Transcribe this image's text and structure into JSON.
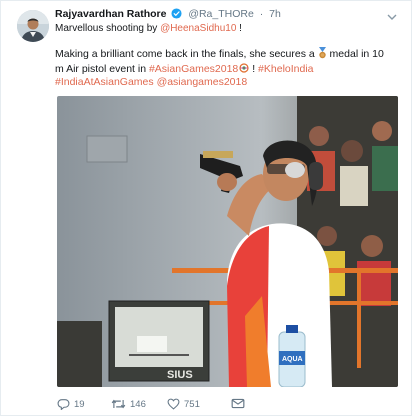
{
  "tweet": {
    "author_name": "Rajyavardhan Rathore",
    "handle": "@Ra_THORe",
    "separator": "·",
    "time": "7h",
    "reply_text_1": "Marvellous shooting by ",
    "reply_mention": "@HeenaSidhu10",
    "reply_text_2": " !",
    "body_part1": "Making a brilliant come back in the finals, she secures a ",
    "body_part2": " medal in 10 m Air pistol event in ",
    "hashtag_asiangames": "#AsianGames2018",
    "body_part3": " ! ",
    "hashtag_kheloindia": "#KheloIndia",
    "hashtag_indiaat": "#IndiaAtAsianGames",
    "mention_asiangames": "@asiangames2018",
    "medal_icon": "bronze-medal-icon",
    "link_color": "#e0694f",
    "verified_color": "#1da1f2"
  },
  "photo": {
    "scoreboard_text": "SIUS",
    "bottle_label": "AQUA"
  },
  "actions": {
    "replies": "19",
    "retweets": "146",
    "likes": "751"
  }
}
